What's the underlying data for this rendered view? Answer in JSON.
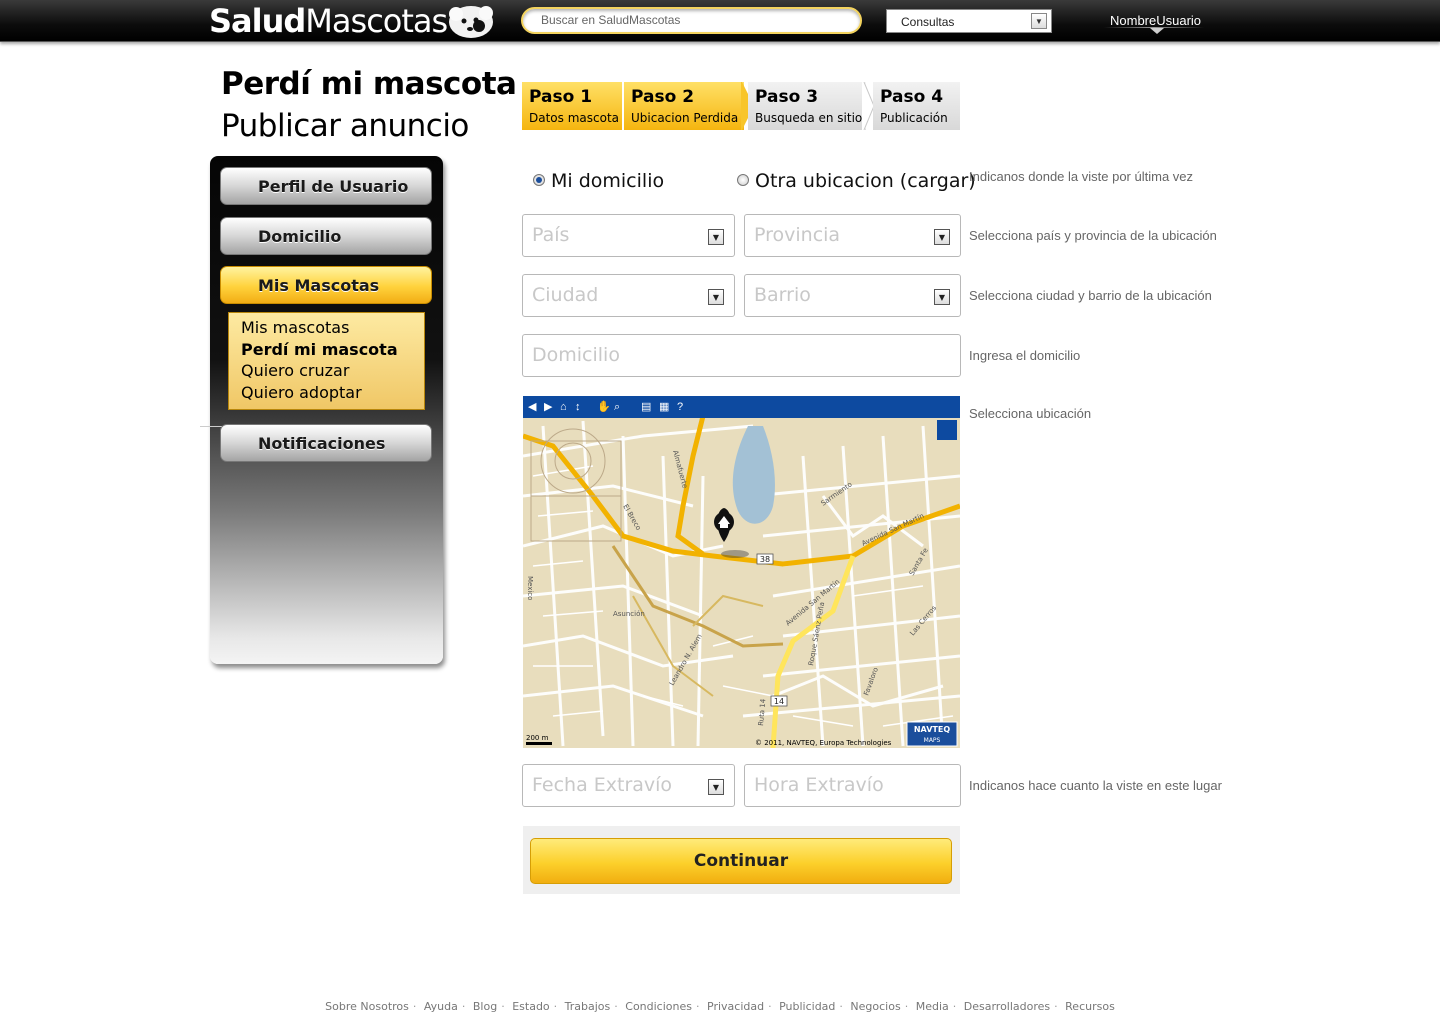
{
  "header": {
    "logo_bold": "Salud",
    "logo_light": "Mascotas",
    "search_placeholder": "Buscar en SaludMascotas",
    "select_value": "Consultas",
    "username": "NombreUsuario"
  },
  "page": {
    "title": "Perdí mi mascota",
    "subtitle": "Publicar anuncio"
  },
  "sidebar": {
    "items": [
      {
        "label": "Perfil de Usuario"
      },
      {
        "label": "Domicilio"
      },
      {
        "label": "Mis Mascotas"
      },
      {
        "label": "Notificaciones"
      }
    ],
    "submenu": [
      {
        "label": "Mis mascotas"
      },
      {
        "label": "Perdí mi mascota"
      },
      {
        "label": "Quiero cruzar"
      },
      {
        "label": "Quiero adoptar"
      }
    ]
  },
  "steps": [
    {
      "number": "Paso 1",
      "label": "Datos mascota"
    },
    {
      "number": "Paso 2",
      "label": "Ubicacion Perdida"
    },
    {
      "number": "Paso 3",
      "label": "Busqueda en sitio"
    },
    {
      "number": "Paso 4",
      "label": "Publicación"
    }
  ],
  "form": {
    "radio_home": "Mi domicilio",
    "radio_other": "Otra ubicacion (cargar)",
    "help_where": "Indicanos donde la viste por última vez",
    "pais": "País",
    "provincia": "Provincia",
    "help_pais": "Selecciona país y provincia de la ubicación",
    "ciudad": "Ciudad",
    "barrio": "Barrio",
    "help_ciudad": "Selecciona ciudad y barrio de la ubicación",
    "domicilio": "Domicilio",
    "help_domicilio": "Ingresa el domicilio",
    "help_map": "Selecciona ubicación",
    "fecha": "Fecha Extravío",
    "hora": "Hora Extravío",
    "help_fecha": "Indicanos hace cuanto la viste en este lugar",
    "continue": "Continuar"
  },
  "map": {
    "scale": "200 m",
    "copyright": "© 2011, NAVTEQ, Europa Technologies",
    "brand_top": "NAVTEQ",
    "brand_bottom": "MAPS",
    "route_a": "38",
    "route_b": "14",
    "streets": [
      "Avenida San Martín",
      "Avenida San Martín",
      "Asunción",
      "Leandro N. Alem",
      "Roque Sáenz Peña",
      "Mexico",
      "El Breco",
      "Favaloro",
      "Las Cerros",
      "Almafuerte",
      "Sarmiento",
      "Santa Fe",
      "Ruta 14"
    ]
  },
  "footer": {
    "links": [
      "Sobre Nosotros",
      "Ayuda",
      "Blog",
      "Estado",
      "Trabajos",
      "Condiciones",
      "Privacidad",
      "Publicidad",
      "Negocios",
      "Media",
      "Desarrolladores",
      "Recursos"
    ]
  }
}
